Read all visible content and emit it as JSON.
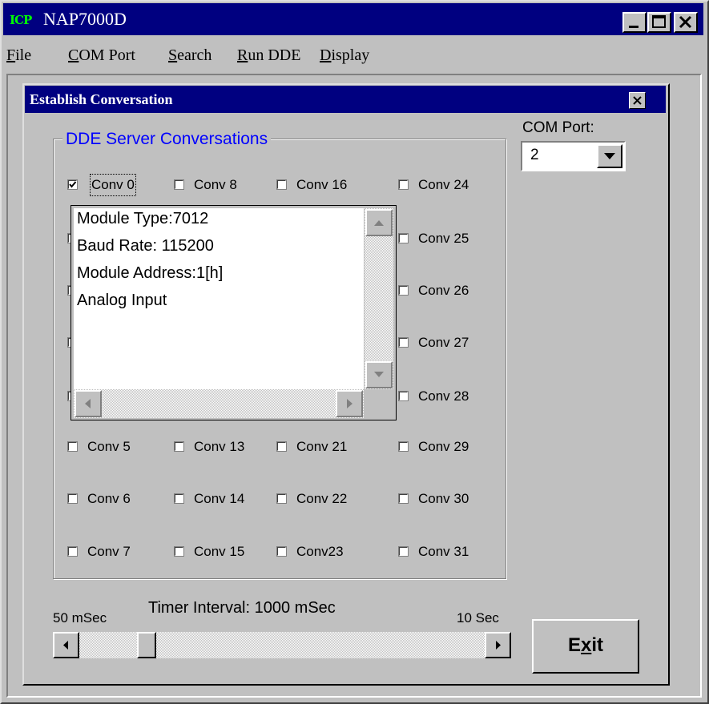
{
  "window": {
    "title": "NAP7000D",
    "icon_text": "ICP",
    "title_color": "#000080",
    "controls": [
      "minimize-icon",
      "maximize-icon",
      "close-icon"
    ]
  },
  "menu": {
    "items": [
      {
        "label": "File",
        "mnemonic": "F"
      },
      {
        "label": "COM Port",
        "mnemonic": "C"
      },
      {
        "label": "Search",
        "mnemonic": "S"
      },
      {
        "label": "Run DDE",
        "mnemonic": "R"
      },
      {
        "label": "Display",
        "mnemonic": "D"
      }
    ]
  },
  "dialog": {
    "title": "Establish Conversation",
    "group_title": "DDE Server Conversations",
    "group_title_color": "#0000ff",
    "conversations": {
      "col1": [
        {
          "label": "Conv 0",
          "checked": true
        },
        {
          "label": "",
          "checked": false
        },
        {
          "label": "",
          "checked": false
        },
        {
          "label": "",
          "checked": false
        },
        {
          "label": "",
          "checked": false
        },
        {
          "label": "Conv 5",
          "checked": false
        },
        {
          "label": "Conv 6",
          "checked": false
        },
        {
          "label": "Conv 7",
          "checked": false
        }
      ],
      "col2": [
        {
          "label": "Conv 8",
          "checked": false
        },
        {
          "label": "Conv 13",
          "checked": false
        },
        {
          "label": "Conv 14",
          "checked": false
        },
        {
          "label": "Conv 15",
          "checked": false
        }
      ],
      "col3": [
        {
          "label": "Conv 16",
          "checked": false
        },
        {
          "label": "Conv 21",
          "checked": false
        },
        {
          "label": "Conv 22",
          "checked": false
        },
        {
          "label": "Conv23",
          "checked": false
        }
      ],
      "col4": [
        {
          "label": "Conv 24",
          "checked": false
        },
        {
          "label": "Conv 25",
          "checked": false
        },
        {
          "label": "Conv 26",
          "checked": false
        },
        {
          "label": "Conv 27",
          "checked": false
        },
        {
          "label": "Conv 28",
          "checked": false
        },
        {
          "label": "Conv 29",
          "checked": false
        },
        {
          "label": "Conv 30",
          "checked": false
        },
        {
          "label": "Conv 31",
          "checked": false
        }
      ]
    },
    "com_port": {
      "label": "COM Port:",
      "value": "2"
    },
    "info_panel": {
      "lines": [
        "Module Type:7012",
        "Baud Rate: 115200",
        "Module Address:1[h]",
        "Analog Input"
      ]
    },
    "timer": {
      "label": "Timer Interval: 1000 mSec",
      "min_label": "50 mSec",
      "max_label": "10 Sec",
      "position_fraction": 0.15
    },
    "exit_button": {
      "label": "Exit",
      "mnemonic": "x"
    }
  }
}
